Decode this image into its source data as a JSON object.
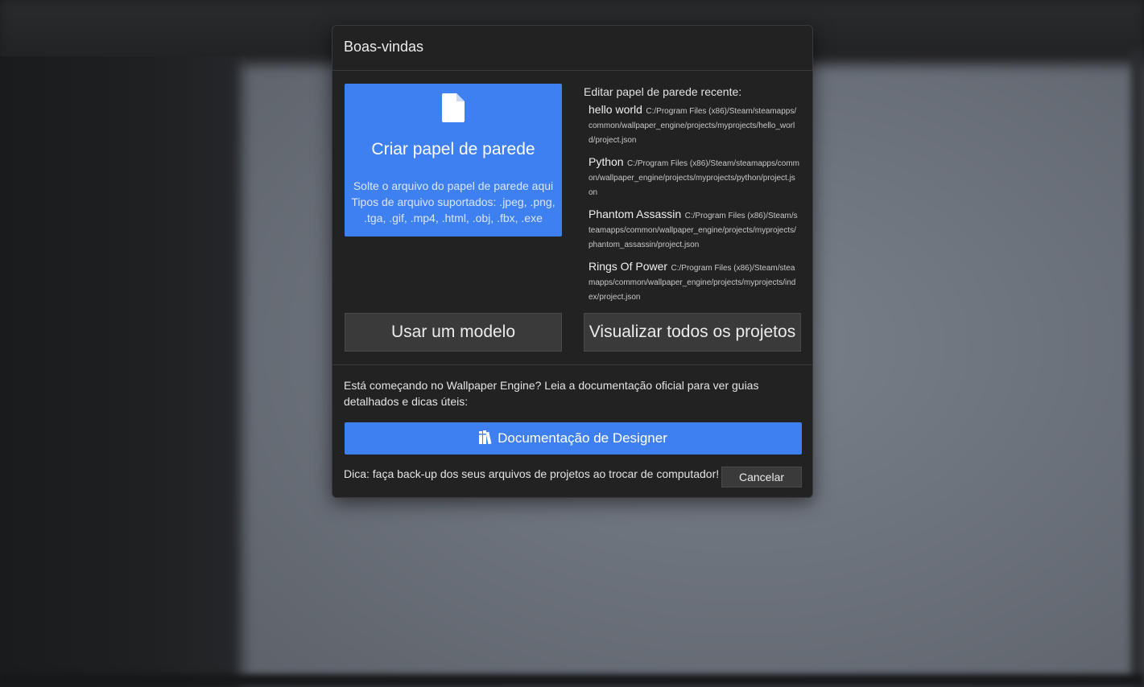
{
  "dialog": {
    "title": "Boas-vindas",
    "create": {
      "icon": "file-icon",
      "title": "Criar papel de parede",
      "hint_line1": "Solte o arquivo do papel de parede aqui",
      "hint_line2": "Tipos de arquivo suportados: .jpeg, .png, .tga, .gif, .mp4, .html, .obj, .fbx, .exe",
      "color": "#3f80f0"
    },
    "recent": {
      "heading": "Editar papel de parede recente:",
      "items": [
        {
          "name": "hello world",
          "path": "C:/Program Files (x86)/Steam/steamapps/common/wallpaper_engine/projects/myprojects/hello_world/project.json"
        },
        {
          "name": "Python",
          "path": "C:/Program Files (x86)/Steam/steamapps/common/wallpaper_engine/projects/myprojects/python/project.json"
        },
        {
          "name": "Phantom Assassin",
          "path": "C:/Program Files (x86)/Steam/steamapps/common/wallpaper_engine/projects/myprojects/phantom_assassin/project.json"
        },
        {
          "name": "Rings Of Power",
          "path": "C:/Program Files (x86)/Steam/steamapps/common/wallpaper_engine/projects/myprojects/index/project.json"
        }
      ]
    },
    "use_template_label": "Usar um modelo",
    "view_all_label": "Visualizar todos os projetos",
    "intro_text": "Está começando no Wallpaper Engine? Leia a documentação oficial para ver guias detalhados e dicas úteis:",
    "docs_button": {
      "icon": "books-icon",
      "label": "Documentação de Designer"
    },
    "tip_text": "Dica: faça back-up dos seus arquivos de projetos ao trocar de computador!",
    "cancel_label": "Cancelar"
  }
}
